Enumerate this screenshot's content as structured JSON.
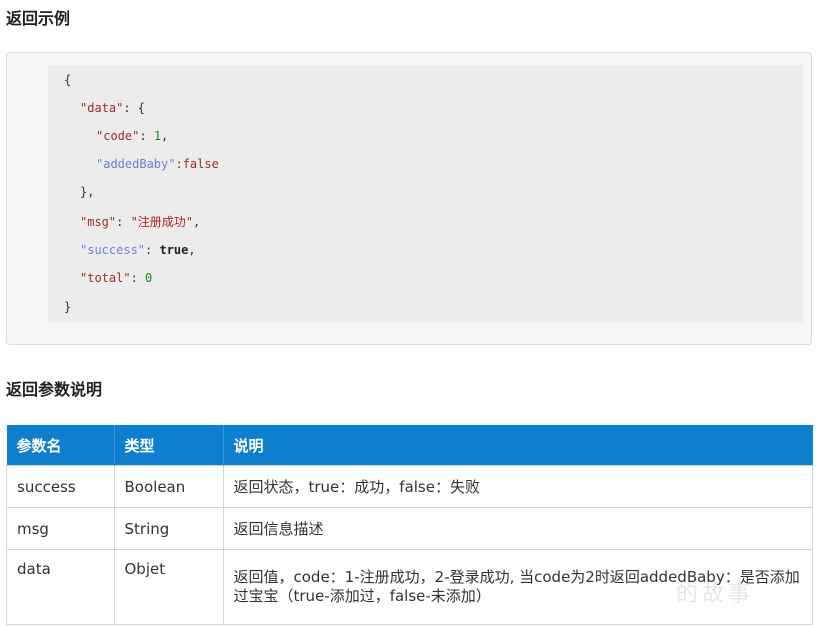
{
  "headings": {
    "example": "返回示例",
    "params": "返回参数说明"
  },
  "code": {
    "l1": "{",
    "l2_key": "\"data\"",
    "l2_rest": ": {",
    "l3_key": "\"code\"",
    "l3_sep": ": ",
    "l3_val": "1",
    "l3_end": ",",
    "l4_key": "\"addedBaby\"",
    "l4_rest": ":false",
    "l5": "},",
    "l6_key": "\"msg\"",
    "l6_sep": ": ",
    "l6_val": "\"注册成功\"",
    "l6_end": ",",
    "l7_key": "\"success\"",
    "l7_sep": ": ",
    "l7_val": "true",
    "l7_end": ",",
    "l8_key": "\"total\"",
    "l8_sep": ": ",
    "l8_val": "0",
    "l9": "}"
  },
  "table": {
    "headers": [
      "参数名",
      "类型",
      "说明"
    ],
    "rows": [
      [
        "success",
        "Boolean",
        "返回状态，true：成功，false：失败"
      ],
      [
        "msg",
        "String",
        "返回信息描述"
      ],
      [
        "data",
        "Objet",
        "返回值，code：1-注册成功，2-登录成功, 当code为2时返回addedBaby：是否添加过宝宝（true-添加过，false-未添加）"
      ]
    ]
  },
  "watermark": "的故事"
}
